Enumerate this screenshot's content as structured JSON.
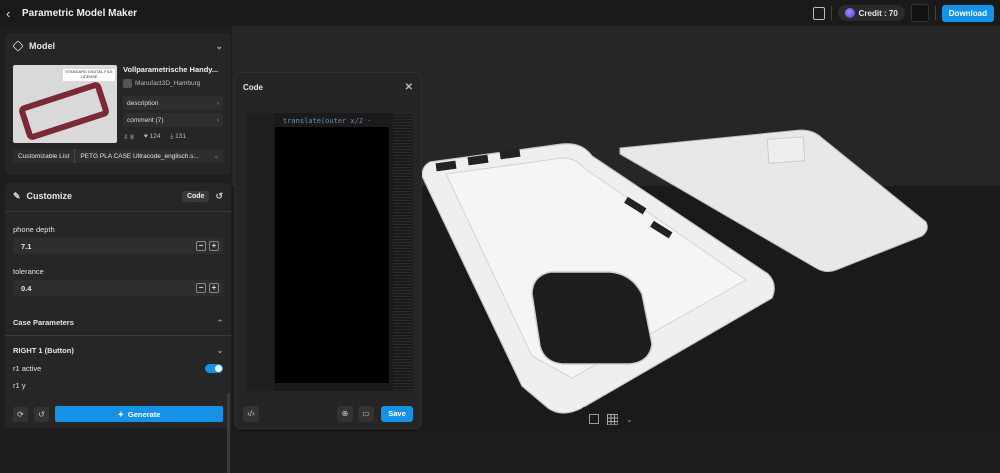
{
  "header": {
    "back_icon": "chevron-left-icon",
    "title": "Parametric Model Maker",
    "credit_label": "Credit : 70",
    "download_label": "Download"
  },
  "model": {
    "section_title": "Model",
    "name": "Vollparametrische Handy...",
    "author": "Manufact3D_Hamburg",
    "description_label": "description",
    "comment_label": "comment  (7)",
    "stats": {
      "downloads_small": "8",
      "likes": "124",
      "downloads": "131"
    },
    "customizable_list_label": "Customizable List",
    "customizable_list_value": "PETG PLA CASE Ultracode_englisch.s...",
    "thumb_license": "STANDARD DIGITAL FILE LICENSE"
  },
  "customize": {
    "section_title": "Customize",
    "code_button": "Code",
    "fields": [
      {
        "label": "phone depth",
        "value": "7.1"
      },
      {
        "label": "tolerance",
        "value": "0.4"
      }
    ],
    "case_parameters_label": "Case Parameters",
    "right1_label": "RIGHT 1 (Button)",
    "r1_active_label": "r1 active",
    "r1_y_label": "r1 y",
    "generate_label": "Generate"
  },
  "code_panel": {
    "title": "Code",
    "code_snippet": "translate(outer x/2 -",
    "save_label": "Save"
  },
  "colors": {
    "accent": "#1592e6",
    "case_thumb": "#7a2a35",
    "panel": "#262626"
  }
}
